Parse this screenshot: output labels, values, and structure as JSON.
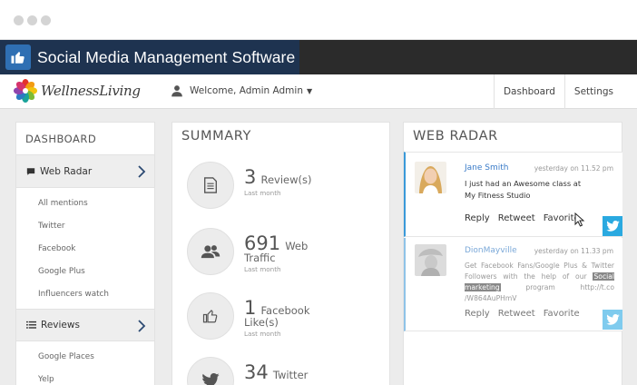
{
  "app": {
    "title": "Social Media Management Software",
    "logo_text": "WellnessLiving"
  },
  "nav": {
    "welcome": "Welcome, Admin Admin",
    "links": [
      "Dashboard",
      "Settings"
    ]
  },
  "sidebar": {
    "heading": "DASHBOARD",
    "web_radar": {
      "label": "Web Radar",
      "items": [
        "All mentions",
        "Twitter",
        "Facebook",
        "Google Plus",
        "Influencers watch"
      ]
    },
    "reviews": {
      "label": "Reviews",
      "items": [
        "Google Places",
        "Yelp"
      ]
    }
  },
  "summary": {
    "title": "SUMMARY",
    "rows": [
      {
        "number": "3",
        "label": "Review(s)",
        "sub": "Last month",
        "icon": "document-icon"
      },
      {
        "number": "691",
        "label": "Web",
        "label2": "Traffic",
        "sub": "Last month",
        "icon": "users-icon"
      },
      {
        "number": "1",
        "label": "Facebook",
        "label2": "Like(s)",
        "sub": "Last month",
        "icon": "thumbs-up-icon"
      },
      {
        "number": "34",
        "label": "Twitter",
        "icon": "twitter-bird-icon"
      }
    ]
  },
  "radar": {
    "title": "WEB RADAR",
    "items": [
      {
        "name": "Jane Smith",
        "time": "yesterday on 11.52 pm",
        "text_line1": "I just had an Awesome class at",
        "text_line2": "My Fitness Studio",
        "actions": [
          "Reply",
          "Retweet",
          "Favorite"
        ]
      },
      {
        "name": "DionMayville",
        "time": "yesterday on 11.33 pm",
        "text_before": "Get Facebook Fans/Google Plus & Twitter Followers with the help of our",
        "text_highlight": "Social marketing",
        "text_after": "program http://t.co /W864AuPHmV",
        "actions": [
          "Reply",
          "Retweet",
          "Favorite"
        ]
      }
    ]
  },
  "colors": {
    "accent": "#3a9ad9",
    "twitter": "#2aa9e0",
    "titlebar": "#2b2b2b",
    "title_box": "#1e3350",
    "name_link": "#3a7bc8"
  }
}
